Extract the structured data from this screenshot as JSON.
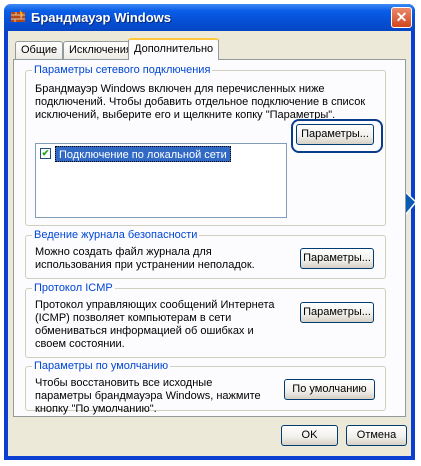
{
  "window": {
    "title": "Брандмауэр Windows",
    "close_symbol": "✕"
  },
  "tabs": [
    {
      "label": "Общие"
    },
    {
      "label": "Исключения"
    },
    {
      "label": "Дополнительно"
    }
  ],
  "network": {
    "legend": "Параметры сетевого подключения",
    "description": "Брандмауэр Windows включен для перечисленных ниже подключений. Чтобы добавить отдельное подключение в список исключений, выберите его и щелкните копку \"Параметры\".",
    "connections": [
      {
        "label": "Подключение по локальной сети",
        "checked": true
      }
    ],
    "settings_button": "Параметры..."
  },
  "logging": {
    "legend": "Ведение журнала безопасности",
    "description": "Можно создать файл журнала для использования при устранении неполадок.",
    "settings_button": "Параметры..."
  },
  "icmp": {
    "legend": "Протокол ICMP",
    "description": "Протокол управляющих сообщений Интернета (ICMP) позволяет компьютерам в сети обмениваться информацией об ошибках и своем состоянии.",
    "settings_button": "Параметры..."
  },
  "defaults": {
    "legend": "Параметры по умолчанию",
    "description": "Чтобы восстановить все исходные параметры брандмауэра Windows, нажмите кнопку \"По умолчанию\".",
    "default_button": "По умолчанию"
  },
  "footer": {
    "ok_label": "OK",
    "cancel_label": "Отмена"
  },
  "colors": {
    "titlebar": "#0650d6",
    "legend_text": "#0046d5",
    "annotation_arrow": "#0a5bb5"
  }
}
